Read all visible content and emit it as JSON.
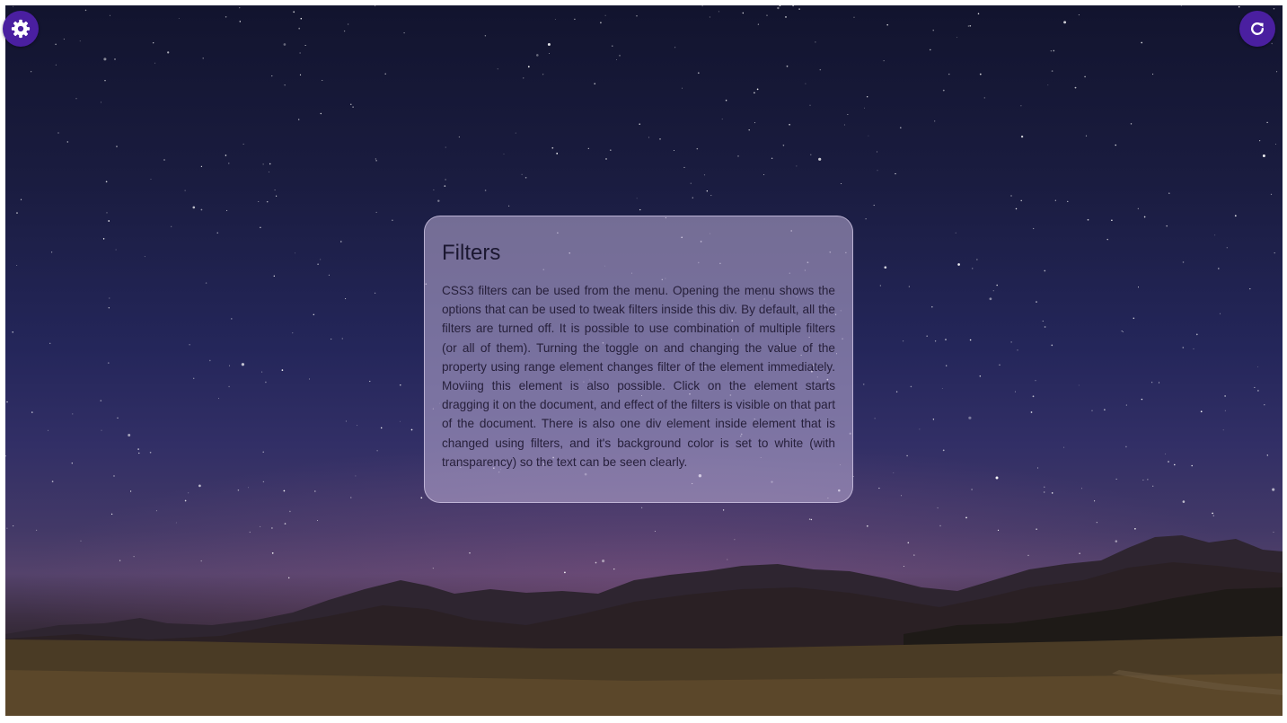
{
  "controls": {
    "settings_icon": "gear-icon",
    "refresh_icon": "refresh-icon",
    "button_color": "#4a1fa0"
  },
  "panel": {
    "title": "Filters",
    "body": "CSS3 filters can be used from the menu. Opening the menu shows the options that can be used to tweak filters inside this div. By default, all the filters are turned off. It is possible to use combination of multiple filters (or all of them). Turning the toggle on and changing the value of the property using range element changes filter of the element immediately. Moviing this element is also possible. Click on the element starts dragging it on the document, and effect of the filters is visible on that part of the document. There is also one div element inside element that is changed using filters, and it's background color is set to white (with transparency) so the text can be seen clearly."
  }
}
